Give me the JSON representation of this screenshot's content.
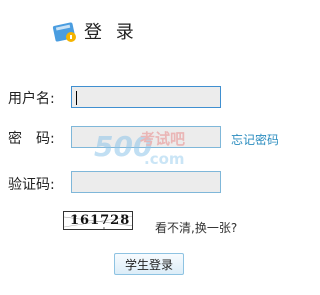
{
  "header": {
    "title": "登 录",
    "icon": "login-card-icon"
  },
  "form": {
    "username_label": "用户名:",
    "username_value": "",
    "password_label": "密　码:",
    "password_value": "",
    "captcha_label": "验证码:",
    "captcha_value": "",
    "forgot_password_link": "忘记密码",
    "captcha_image_text": "161728",
    "refresh_captcha_link": "看不清,换一张?",
    "submit_button": "学生登录"
  },
  "watermark": {
    "text": "考试吧",
    "sub": ".com",
    "number": "500"
  },
  "colors": {
    "field_border": "#7fb7d9",
    "field_bg": "#ececec",
    "link": "#2a8cbf",
    "button_border": "#8ec3e2"
  }
}
